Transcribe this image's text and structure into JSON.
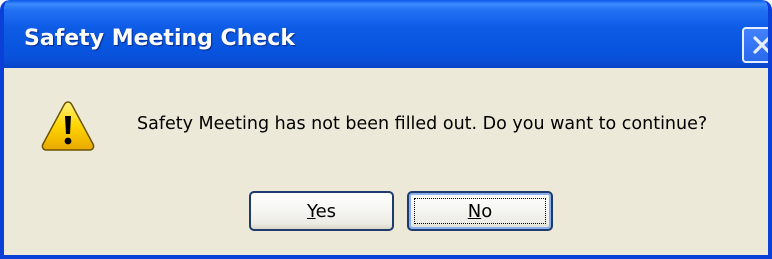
{
  "window": {
    "title": "Safety Meeting Check",
    "close_icon": "close-icon"
  },
  "dialog": {
    "icon": "warning-icon",
    "message": "Safety Meeting has not been filled out. Do you want to continue?"
  },
  "buttons": {
    "yes": {
      "accel": "Y",
      "rest": "es"
    },
    "no": {
      "accel": "N",
      "rest": "o"
    }
  },
  "colors": {
    "titlebar": "#0a5ae8",
    "dialog_background": "#ece9d8",
    "warning_yellow": "#ffd200"
  }
}
